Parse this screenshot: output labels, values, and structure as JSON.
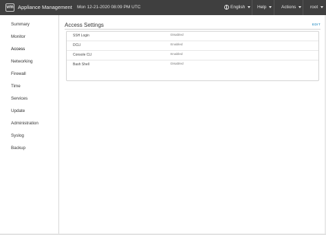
{
  "header": {
    "logo": "vm",
    "title": "Appliance Management",
    "datetime": "Mon 12-21-2020 08:09 PM UTC",
    "language": "English",
    "help": "Help",
    "actions": "Actions",
    "user": "root"
  },
  "sidebar": {
    "items": [
      {
        "label": "Summary"
      },
      {
        "label": "Monitor"
      },
      {
        "label": "Access"
      },
      {
        "label": "Networking"
      },
      {
        "label": "Firewall"
      },
      {
        "label": "Time"
      },
      {
        "label": "Services"
      },
      {
        "label": "Update"
      },
      {
        "label": "Administration"
      },
      {
        "label": "Syslog"
      },
      {
        "label": "Backup"
      }
    ],
    "active": "Access"
  },
  "main": {
    "title": "Access Settings",
    "edit_label": "EDIT",
    "rows": [
      {
        "label": "SSH Login",
        "value": "Disabled"
      },
      {
        "label": "DCLI",
        "value": "Enabled"
      },
      {
        "label": "Console CLI",
        "value": "Enabled"
      },
      {
        "label": "Bash Shell",
        "value": "Disabled"
      }
    ]
  },
  "colors": {
    "topbar": "#3f3f3f",
    "link": "#0079b8"
  }
}
